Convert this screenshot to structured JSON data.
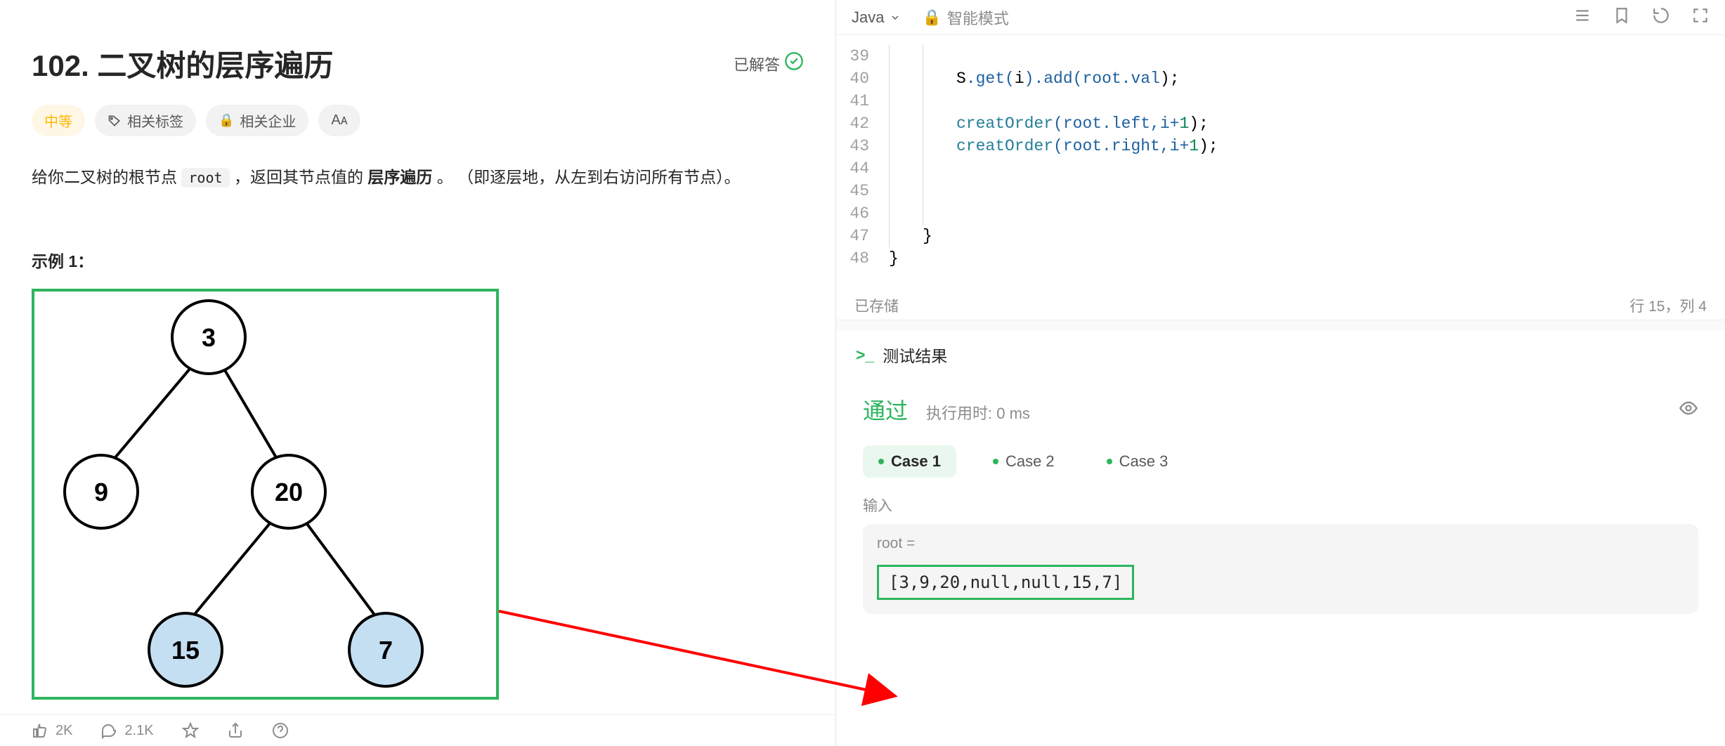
{
  "problem": {
    "number": "102.",
    "title": "二叉树的层序遍历",
    "solved_label": "已解答",
    "difficulty": "中等",
    "tags_label": "相关标签",
    "companies_label": "相关企业",
    "hint_label": "Aᴀ",
    "description_prefix": "给你二叉树的根节点 ",
    "description_code": "root",
    "description_mid": " ，返回其节点值的 ",
    "description_bold": "层序遍历",
    "description_suffix_1": " 。",
    "description_suffix_2": " （即逐层地，从左到右访问所有节点）。",
    "example_label": "示例 1："
  },
  "tree": {
    "nodes": {
      "n3": "3",
      "n9": "9",
      "n20": "20",
      "n15": "15",
      "n7": "7"
    }
  },
  "footer": {
    "likes": "2K",
    "comments": "2.1K"
  },
  "editor": {
    "language": "Java",
    "mode_label": "智能模式",
    "saved_label": "已存储",
    "position_label": "行 15，列 4",
    "lines": {
      "l39": "39",
      "l40": "40",
      "l41": "41",
      "l42": "42",
      "l43": "43",
      "l44": "44",
      "l45": "45",
      "l46": "46",
      "l47": "47",
      "l48": "48"
    },
    "code": {
      "c40_a": "S",
      "c40_b": ".get(",
      "c40_c": "i",
      "c40_d": ").add(",
      "c40_e": "root.val",
      "c40_f": ");",
      "c42_a": "creatOrder",
      "c42_b": "(root.left,i+",
      "c42_c": "1",
      "c42_d": ");",
      "c43_a": "creatOrder",
      "c43_b": "(root.right,i+",
      "c43_c": "1",
      "c43_d": ");",
      "c47": "}",
      "c48": "}"
    }
  },
  "results": {
    "header": "测试结果",
    "pass_label": "通过",
    "runtime_label": "执行用时: 0 ms",
    "cases": {
      "c1": "Case 1",
      "c2": "Case 2",
      "c3": "Case 3"
    },
    "input_label": "输入",
    "root_label": "root =",
    "root_value": "[3,9,20,null,null,15,7]"
  }
}
